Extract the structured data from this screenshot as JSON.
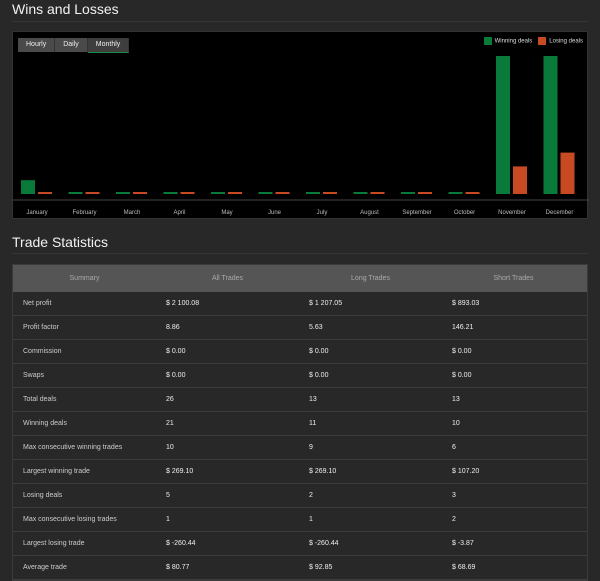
{
  "wins_section": {
    "title": "Wins and Losses"
  },
  "period_buttons": [
    {
      "label": "Hourly"
    },
    {
      "label": "Daily"
    },
    {
      "label": "Monthly",
      "active": true
    }
  ],
  "chart_data": {
    "type": "bar",
    "categories": [
      "January",
      "February",
      "March",
      "April",
      "May",
      "June",
      "July",
      "August",
      "September",
      "October",
      "November",
      "December"
    ],
    "series": [
      {
        "name": "Winning deals",
        "color": "#0a7a3a",
        "values": [
          1,
          0,
          0,
          0,
          0,
          0,
          0,
          0,
          0,
          0,
          10,
          10
        ]
      },
      {
        "name": "Losing deals",
        "color": "#c84a22",
        "values": [
          0,
          0,
          0,
          0,
          0,
          0,
          0,
          0,
          0,
          0,
          2,
          3
        ]
      }
    ],
    "ylim": [
      0,
      10
    ],
    "legend": "top-right",
    "grid": false
  },
  "stats_section": {
    "title": "Trade Statistics"
  },
  "table": {
    "headers": [
      "Summary",
      "All Trades",
      "Long Trades",
      "Short Trades"
    ],
    "rows": [
      [
        "Net profit",
        "$ 2 100.08",
        "$ 1 207.05",
        "$ 893.03"
      ],
      [
        "Profit factor",
        "8.86",
        "5.63",
        "146.21"
      ],
      [
        "Commission",
        "$ 0.00",
        "$ 0.00",
        "$ 0.00"
      ],
      [
        "Swaps",
        "$ 0.00",
        "$ 0.00",
        "$ 0.00"
      ],
      [
        "Total deals",
        "26",
        "13",
        "13"
      ],
      [
        "Winning deals",
        "21",
        "11",
        "10"
      ],
      [
        "Max consecutive winning trades",
        "10",
        "9",
        "6"
      ],
      [
        "Largest winning trade",
        "$ 269.10",
        "$ 269.10",
        "$ 107.20"
      ],
      [
        "Losing deals",
        "5",
        "2",
        "3"
      ],
      [
        "Max consecutive losing trades",
        "1",
        "1",
        "2"
      ],
      [
        "Largest losing trade",
        "$ -260.44",
        "$ -260.44",
        "$ -3.87"
      ],
      [
        "Average trade",
        "$ 80.77",
        "$ 92.85",
        "$ 68.69"
      ]
    ]
  }
}
